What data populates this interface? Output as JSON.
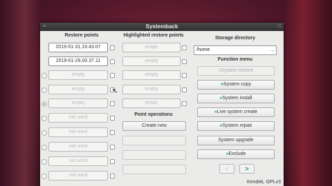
{
  "window": {
    "title": "Systemback",
    "title_buttons": [
      "–",
      "□"
    ]
  },
  "restore_points": {
    "title": "Restore points",
    "items": [
      {
        "label": "2019-01-31,19.43.07",
        "active": true
      },
      {
        "label": "2019-01-29,00.37.11",
        "active": true
      },
      {
        "label": "empty",
        "active": false
      },
      {
        "label": "empty",
        "active": false
      },
      {
        "label": "empty",
        "active": false
      },
      {
        "label": "not used",
        "active": false
      },
      {
        "label": "not used",
        "active": false
      },
      {
        "label": "not used",
        "active": false
      },
      {
        "label": "not used",
        "active": false
      },
      {
        "label": "not used",
        "active": false
      }
    ]
  },
  "highlighted_restore_points": {
    "title": "Highlighted restore points",
    "items": [
      "empty",
      "empty",
      "empty",
      "empty",
      "empty"
    ]
  },
  "point_operations": {
    "title": "Point operations",
    "create_new_label": "Create new",
    "disabled_items": [
      "",
      "",
      ""
    ]
  },
  "storage": {
    "title": "Storage directory",
    "path": "/home",
    "browse_label": "..."
  },
  "function_menu": {
    "title": "Function menu",
    "items": [
      {
        "label": "System restore",
        "enabled": false
      },
      {
        "label": "System copy",
        "enabled": true
      },
      {
        "label": "System install",
        "enabled": true
      },
      {
        "label": "Live system create",
        "enabled": true
      },
      {
        "label": "System repair",
        "enabled": true
      },
      {
        "label": "System upgrade",
        "enabled": true
      },
      {
        "label": "Exclude",
        "enabled": true
      }
    ],
    "chevron": "»"
  },
  "navigation": {
    "prev_label": "<",
    "next_label": ">"
  },
  "footer": {
    "text": "Kendek, GPLv3"
  },
  "colors": {
    "accent": "#1aa05a",
    "titlebar": "#3a3a3a",
    "window_bg": "#ebebea"
  }
}
